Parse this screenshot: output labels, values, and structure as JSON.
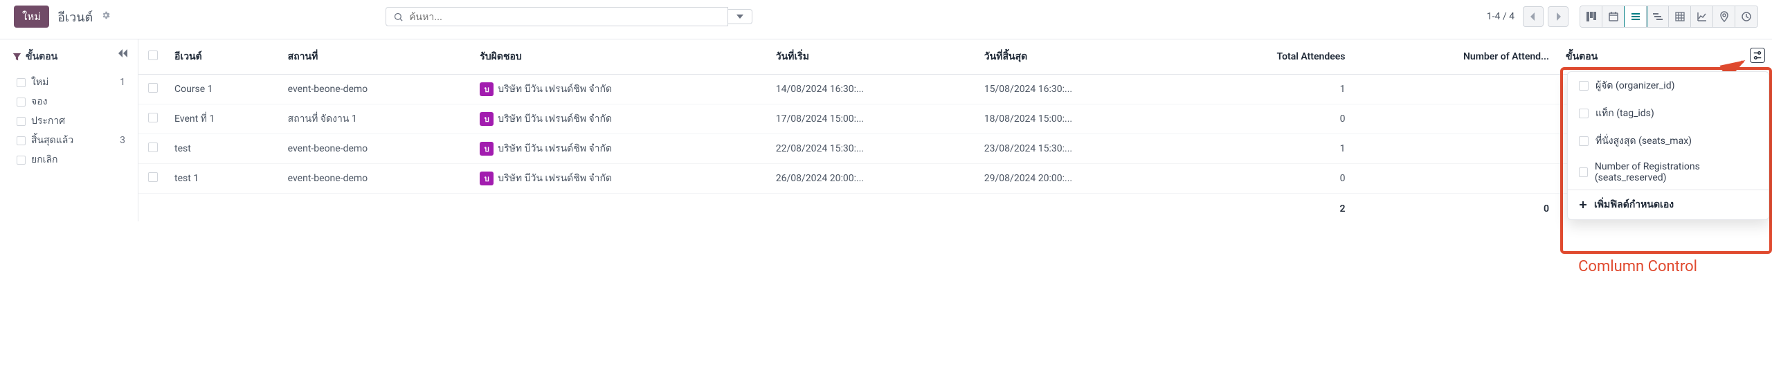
{
  "header": {
    "new_button": "ใหม่",
    "title": "อีเวนต์",
    "search_placeholder": "ค้นหา...",
    "pager": "1-4 / 4"
  },
  "sidebar": {
    "header": "ขั้นตอน",
    "items": [
      {
        "label": "ใหม่",
        "count": "1"
      },
      {
        "label": "จอง",
        "count": ""
      },
      {
        "label": "ประกาศ",
        "count": ""
      },
      {
        "label": "สิ้นสุดแล้ว",
        "count": "3"
      },
      {
        "label": "ยกเลิก",
        "count": ""
      }
    ]
  },
  "table": {
    "columns": {
      "event": "อีเวนต์",
      "location": "สถานที่",
      "responsible": "รับผิดชอบ",
      "date_start": "วันที่เริ่ม",
      "date_end": "วันที่สิ้นสุด",
      "total_attendees": "Total Attendees",
      "num_attend": "Number of Attend...",
      "stage": "ขั้นตอน"
    },
    "rows": [
      {
        "event": "Course 1",
        "location": "event-beone-demo",
        "avatar": "บ",
        "responsible": "บริษัท บีวัน เฟรนด์ชิพ จำกัด",
        "date_start": "14/08/2024 16:30:...",
        "date_end": "15/08/2024 16:30:...",
        "total": "1"
      },
      {
        "event": "Event ที่ 1",
        "location": "สถานที่ จัดงาน 1",
        "avatar": "บ",
        "responsible": "บริษัท บีวัน เฟรนด์ชิพ จำกัด",
        "date_start": "17/08/2024 15:00:...",
        "date_end": "18/08/2024 15:00:...",
        "total": "0"
      },
      {
        "event": "test",
        "location": "event-beone-demo",
        "avatar": "บ",
        "responsible": "บริษัท บีวัน เฟรนด์ชิพ จำกัด",
        "date_start": "22/08/2024 15:30:...",
        "date_end": "23/08/2024 15:30:...",
        "total": "1"
      },
      {
        "event": "test 1",
        "location": "event-beone-demo",
        "avatar": "บ",
        "responsible": "บริษัท บีวัน เฟรนด์ชิพ จำกัด",
        "date_start": "26/08/2024 20:00:...",
        "date_end": "29/08/2024 20:00:...",
        "total": "0"
      }
    ],
    "footer": {
      "total_sum": "2",
      "num_attend_sum": "0"
    }
  },
  "popover": {
    "items": [
      "ผู้จัด (organizer_id)",
      "แท็ก (tag_ids)",
      "ที่นั่งสูงสุด (seats_max)",
      "Number of Registrations (seats_reserved)"
    ],
    "add_custom": "เพิ่มฟิลด์กำหนดเอง"
  },
  "annotation": {
    "label": "Comlumn Control"
  }
}
